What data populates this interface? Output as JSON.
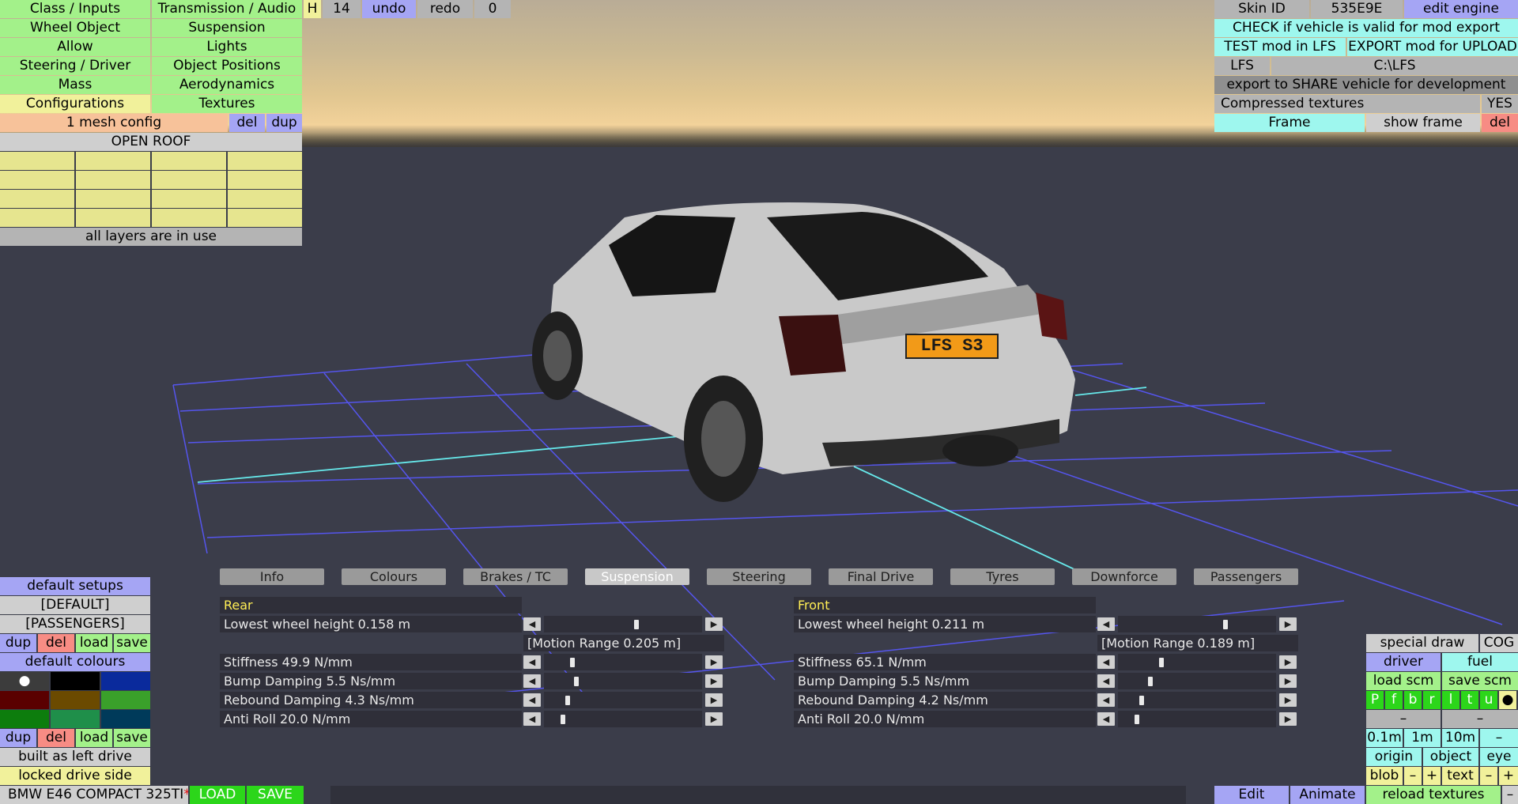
{
  "menu": {
    "class_inputs": "Class / Inputs",
    "transmission_audio": "Transmission / Audio",
    "wheel_object": "Wheel Object",
    "suspension": "Suspension",
    "allow": "Allow",
    "lights": "Lights",
    "steering_driver": "Steering / Driver",
    "object_positions": "Object Positions",
    "mass": "Mass",
    "aerodynamics": "Aerodynamics",
    "configurations": "Configurations",
    "textures": "Textures"
  },
  "history": {
    "h": "H",
    "count": "14",
    "undo": "undo",
    "redo": "redo",
    "redo_count": "0"
  },
  "config": {
    "mesh_config": "1 mesh config",
    "del": "del",
    "dup": "dup",
    "open_roof": "OPEN ROOF",
    "layers_status": "all layers are in use"
  },
  "top_right": {
    "skin_id_label": "Skin ID",
    "skin_id_value": "535E9E",
    "edit_engine": "edit engine",
    "check_valid": "CHECK if vehicle is valid for mod export",
    "test_mod": "TEST mod in LFS",
    "export_mod": "EXPORT mod for UPLOAD",
    "lfs": "LFS",
    "lfs_path": "C:\\LFS",
    "export_share": "export to SHARE vehicle for development",
    "compressed_textures": "Compressed textures",
    "compressed_value": "YES",
    "frame": "Frame",
    "show_frame": "show frame",
    "del": "del"
  },
  "plate": "LFS S3",
  "tabs": [
    "Info",
    "Colours",
    "Brakes / TC",
    "Suspension",
    "Steering",
    "Final Drive",
    "Tyres",
    "Downforce",
    "Passengers"
  ],
  "active_tab": "Suspension",
  "rear": {
    "header": "Rear",
    "lowest_wheel": "Lowest wheel height 0.158 m",
    "motion_range": "[Motion Range 0.205 m]",
    "stiffness": "Stiffness 49.9 N/mm",
    "bump": "Bump Damping 5.5 Ns/mm",
    "rebound": "Rebound Damping 4.3 Ns/mm",
    "antiroll": "Anti Roll 20.0 N/mm"
  },
  "front": {
    "header": "Front",
    "lowest_wheel": "Lowest wheel height 0.211 m",
    "motion_range": "[Motion Range 0.189 m]",
    "stiffness": "Stiffness 65.1 N/mm",
    "bump": "Bump Damping 5.5 Ns/mm",
    "rebound": "Rebound Damping 4.2 Ns/mm",
    "antiroll": "Anti Roll 20.0 N/mm"
  },
  "slider_levels": {
    "rear": {
      "lowest_wheel": 0.58,
      "stiffness": 0.15,
      "bump": 0.18,
      "rebound": 0.12,
      "antiroll": 0.09
    },
    "front": {
      "lowest_wheel": 0.68,
      "stiffness": 0.25,
      "bump": 0.18,
      "rebound": 0.12,
      "antiroll": 0.09
    }
  },
  "arrows": {
    "left": "◀",
    "right": "▶"
  },
  "left_panel": {
    "default_setups": "default setups",
    "default_tag": "[DEFAULT]",
    "passengers_tag": "[PASSENGERS]",
    "dup": "dup",
    "del": "del",
    "load": "load",
    "save": "save",
    "default_colours": "default colours",
    "dot": "●",
    "built_as": "built as left drive",
    "locked": "locked drive side"
  },
  "colour_swatches": [
    "#3c3c3c",
    "#000000",
    "#0a2a9c",
    "#5a0000",
    "#6b4a00",
    "#3aa02a",
    "#0d7d0d",
    "#1f8f4a",
    "#003a5a"
  ],
  "bottom_bar": {
    "vehicle_name": "BMW E46 COMPACT 325TI",
    "asterisk": "*",
    "load": "LOAD",
    "save": "SAVE",
    "edit": "Edit",
    "animate": "Animate",
    "reload_textures": "reload textures",
    "minus": "–"
  },
  "right_panel": {
    "special_draw": "special draw",
    "cog": "COG",
    "driver": "driver",
    "fuel": "fuel",
    "load_scm": "load scm",
    "save_scm": "save scm",
    "flags": [
      "P",
      "f",
      "b",
      "r",
      "l",
      "t",
      "u",
      "●"
    ],
    "dash": "–",
    "scales": [
      "0.1m",
      "1m",
      "10m"
    ],
    "origin": "origin",
    "object": "object",
    "eye": "eye",
    "blob": "blob",
    "plus": "+",
    "text": "text"
  },
  "colors": {
    "accent_green": "#a3f18a",
    "accent_yellow": "#f1f19b",
    "accent_cyan": "#9ef7ee",
    "accent_blue": "#a5a5f4",
    "accent_red": "#f78c84",
    "header_yellow": "#ffee55"
  }
}
